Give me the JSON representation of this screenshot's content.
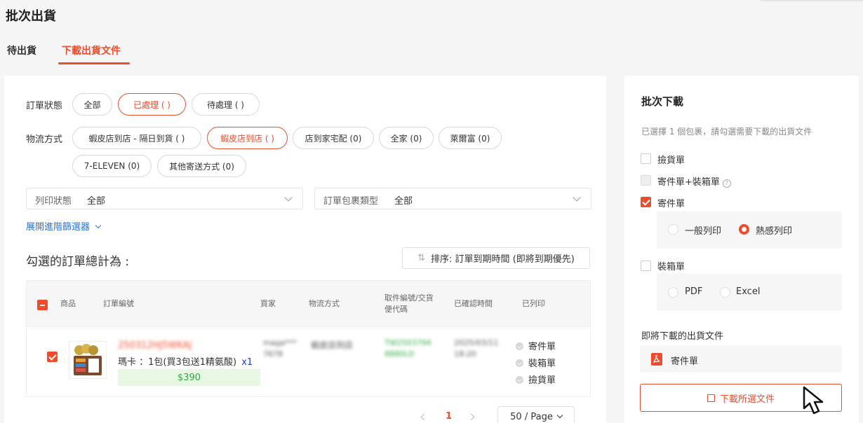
{
  "page": {
    "title": "批次出貨"
  },
  "tabs": [
    {
      "label": "待出貨"
    },
    {
      "label": "下載出貨文件"
    }
  ],
  "filters": {
    "order_status_label": "訂單狀態",
    "order_status_chips": [
      "全部",
      "已處理 (   )",
      "待處理 (   )"
    ],
    "logistics_label": "物流方式",
    "logistics_chips_row1": [
      "蝦皮店到店 - 隔日到貨 (   )",
      "蝦皮店到店 (   )",
      "店到家宅配 (0)",
      "全家 (0)",
      "萊爾富 (0)"
    ],
    "logistics_chips_row2": [
      "7-ELEVEN (0)",
      "其他寄送方式 (0)"
    ],
    "print_status": {
      "label": "列印狀態",
      "value": "全部"
    },
    "package_type": {
      "label": "訂單包裹類型",
      "value": "全部"
    },
    "advanced_link": "展開進階篩選器"
  },
  "summary_label": "勾選的訂單總計為 :",
  "sort_label": "排序: 訂單到期時間 (即將到期優先)",
  "table": {
    "headers": {
      "product": "商品",
      "order_no": "訂單編號",
      "buyer": "買家",
      "logistics": "物流方式",
      "tracking_line1": "取件編號/交貨",
      "tracking_line2": "便代碼",
      "confirmed": "已確認時間",
      "printed": "已列印"
    },
    "row": {
      "order_no": "250312HJ5WKAJ",
      "product_text": "瑪卡 ：1包(買3包送1精氨酸)",
      "qty": "x1",
      "price": "$390",
      "buyer_line1": "maga***",
      "buyer_line2": "7678",
      "logistics": "蝦皮店到店",
      "tracking_line1": "TW2503794",
      "tracking_line2": "8880LD",
      "confirmed_line1": "2025/03/11",
      "confirmed_line2": "18:20",
      "printed": [
        "寄件單",
        "裝箱單",
        "撿貨單"
      ]
    }
  },
  "pagination": {
    "current": "1",
    "page_size": "50 / Page"
  },
  "batch_panel": {
    "title": "批次下載",
    "description": "已選擇 1 個包裹，請勾選需要下載的出貨文件",
    "options": {
      "picking": "撿貨單",
      "shipping_packing": "寄件單+裝箱單",
      "shipping": "寄件單",
      "packing": "裝箱單"
    },
    "shipping_print_modes": [
      "一般列印",
      "熱感列印"
    ],
    "packing_formats": [
      "PDF",
      "Excel"
    ],
    "upcoming_label": "即將下載的出貨文件",
    "upcoming_file": "寄件單",
    "download_button": "下載所選文件"
  },
  "colors": {
    "accent": "#ee4d2d",
    "link": "#2673dd",
    "price_green": "#2bab3e"
  }
}
